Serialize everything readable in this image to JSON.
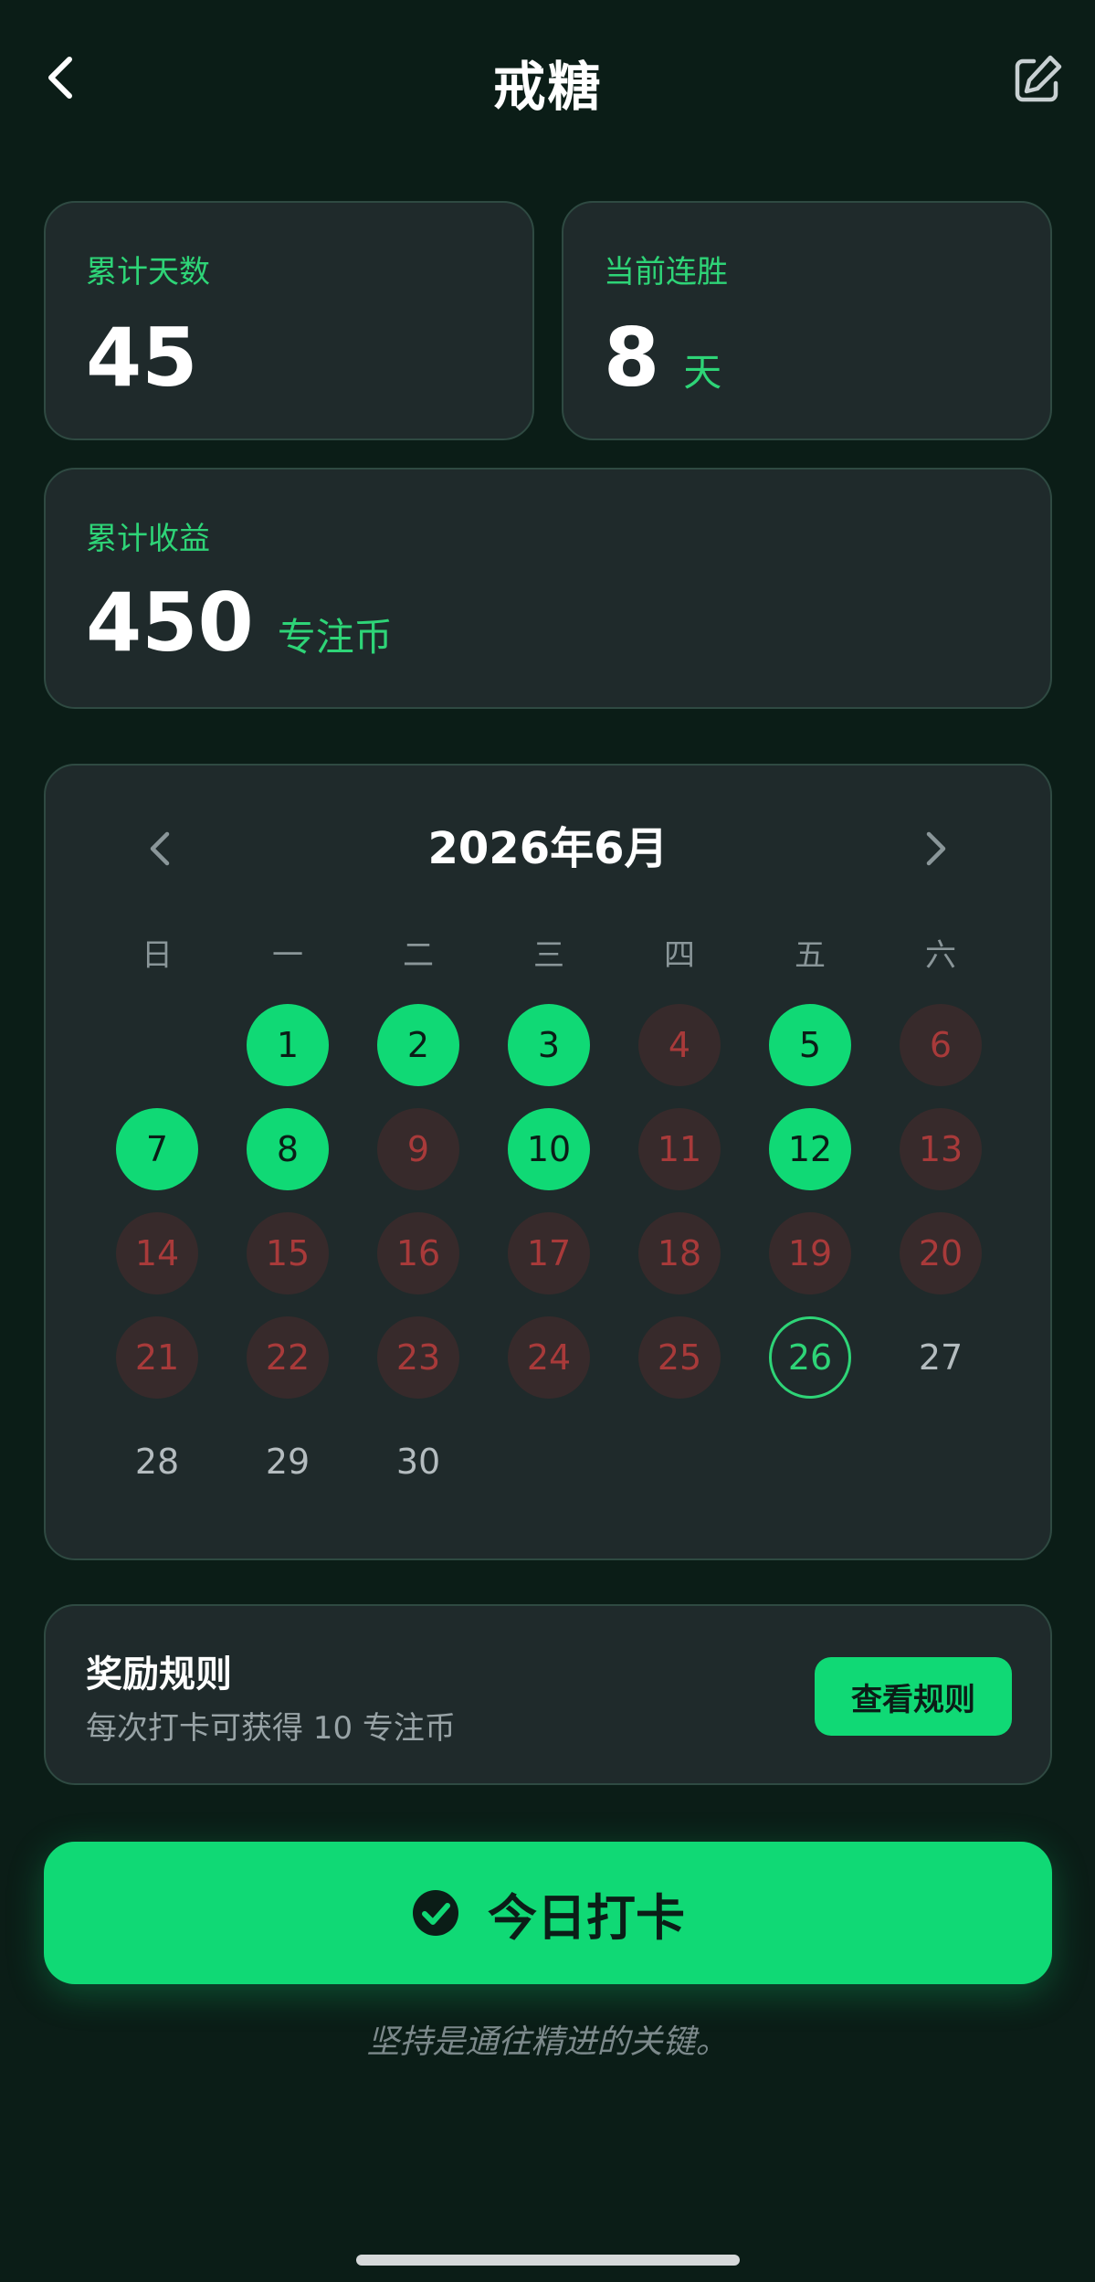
{
  "header": {
    "title": "戒糖",
    "back_icon": "chevron-left-icon",
    "edit_icon": "edit-icon"
  },
  "stats": {
    "total_days_label": "累计天数",
    "total_days_value": "45",
    "streak_label": "当前连胜",
    "streak_value": "8",
    "streak_unit": "天",
    "earnings_label": "累计收益",
    "earnings_value": "450",
    "earnings_unit": "专注币"
  },
  "calendar": {
    "title": "2026年6月",
    "weekdays": [
      "日",
      "一",
      "二",
      "三",
      "四",
      "五",
      "六"
    ],
    "first_weekday": 1,
    "days": [
      {
        "day": "1",
        "status": "done"
      },
      {
        "day": "2",
        "status": "done"
      },
      {
        "day": "3",
        "status": "done"
      },
      {
        "day": "4",
        "status": "missed"
      },
      {
        "day": "5",
        "status": "done"
      },
      {
        "day": "6",
        "status": "missed"
      },
      {
        "day": "7",
        "status": "done"
      },
      {
        "day": "8",
        "status": "done"
      },
      {
        "day": "9",
        "status": "missed"
      },
      {
        "day": "10",
        "status": "done"
      },
      {
        "day": "11",
        "status": "missed"
      },
      {
        "day": "12",
        "status": "done"
      },
      {
        "day": "13",
        "status": "missed"
      },
      {
        "day": "14",
        "status": "missed"
      },
      {
        "day": "15",
        "status": "missed"
      },
      {
        "day": "16",
        "status": "missed"
      },
      {
        "day": "17",
        "status": "missed"
      },
      {
        "day": "18",
        "status": "missed"
      },
      {
        "day": "19",
        "status": "missed"
      },
      {
        "day": "20",
        "status": "missed"
      },
      {
        "day": "21",
        "status": "missed"
      },
      {
        "day": "22",
        "status": "missed"
      },
      {
        "day": "23",
        "status": "missed"
      },
      {
        "day": "24",
        "status": "missed"
      },
      {
        "day": "25",
        "status": "missed"
      },
      {
        "day": "26",
        "status": "today"
      },
      {
        "day": "27",
        "status": "future"
      },
      {
        "day": "28",
        "status": "future"
      },
      {
        "day": "29",
        "status": "future"
      },
      {
        "day": "30",
        "status": "future"
      }
    ]
  },
  "rules": {
    "title": "奖励规则",
    "description": "每次打卡可获得 10 专注币",
    "button_label": "查看规则"
  },
  "checkin": {
    "label": "今日打卡",
    "icon": "check-circle-icon"
  },
  "motto": "坚持是通往精进的关键。",
  "colors": {
    "background": "#0b1d17",
    "card": "#1f2a2b",
    "accent": "#10d975",
    "missed": "#a83a3a"
  }
}
